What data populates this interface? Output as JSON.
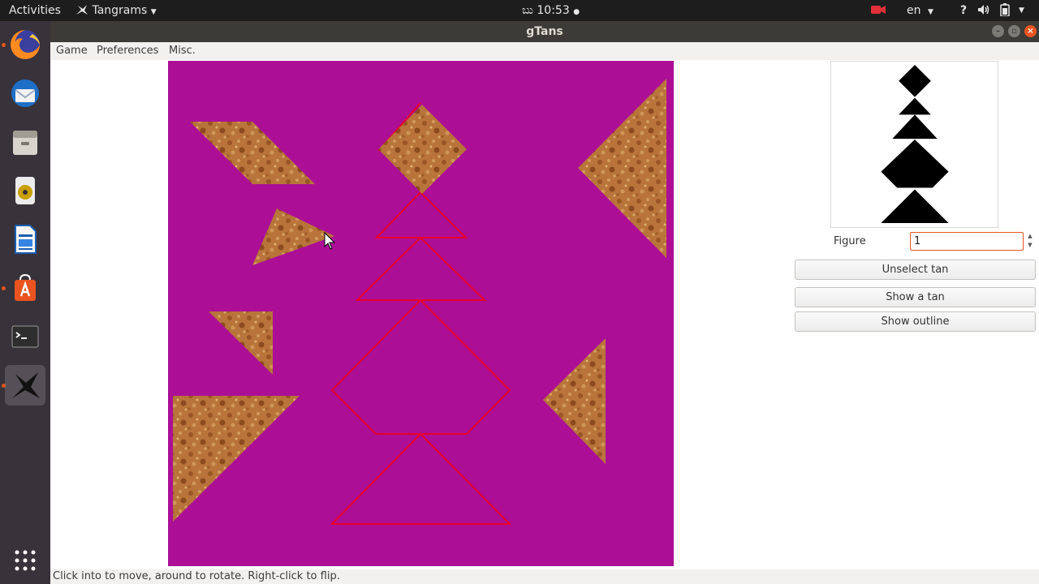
{
  "topbar": {
    "activities": "Activities",
    "app_menu": "Tangrams",
    "clock": "ಬು 10:53",
    "language": "en",
    "help": "?"
  },
  "window": {
    "title": "gTans"
  },
  "menu": {
    "game": "Game",
    "preferences": "Preferences",
    "misc": "Misc."
  },
  "side": {
    "figure_label": "Figure",
    "figure_value": "1",
    "unselect_tan": "Unselect tan",
    "show_tan": "Show a tan",
    "show_outline": "Show outline"
  },
  "status": "Click into to move, around to rotate. Right-click to flip.",
  "colors": {
    "board_background": "#ac0f96",
    "outline": "#e8002a",
    "accent": "#e95420"
  },
  "dock_icons": [
    "firefox-icon",
    "thunderbird-icon",
    "files-icon",
    "rhythmbox-icon",
    "writer-icon",
    "software-icon",
    "terminal-icon",
    "tangrams-icon",
    "app-grid-icon"
  ]
}
